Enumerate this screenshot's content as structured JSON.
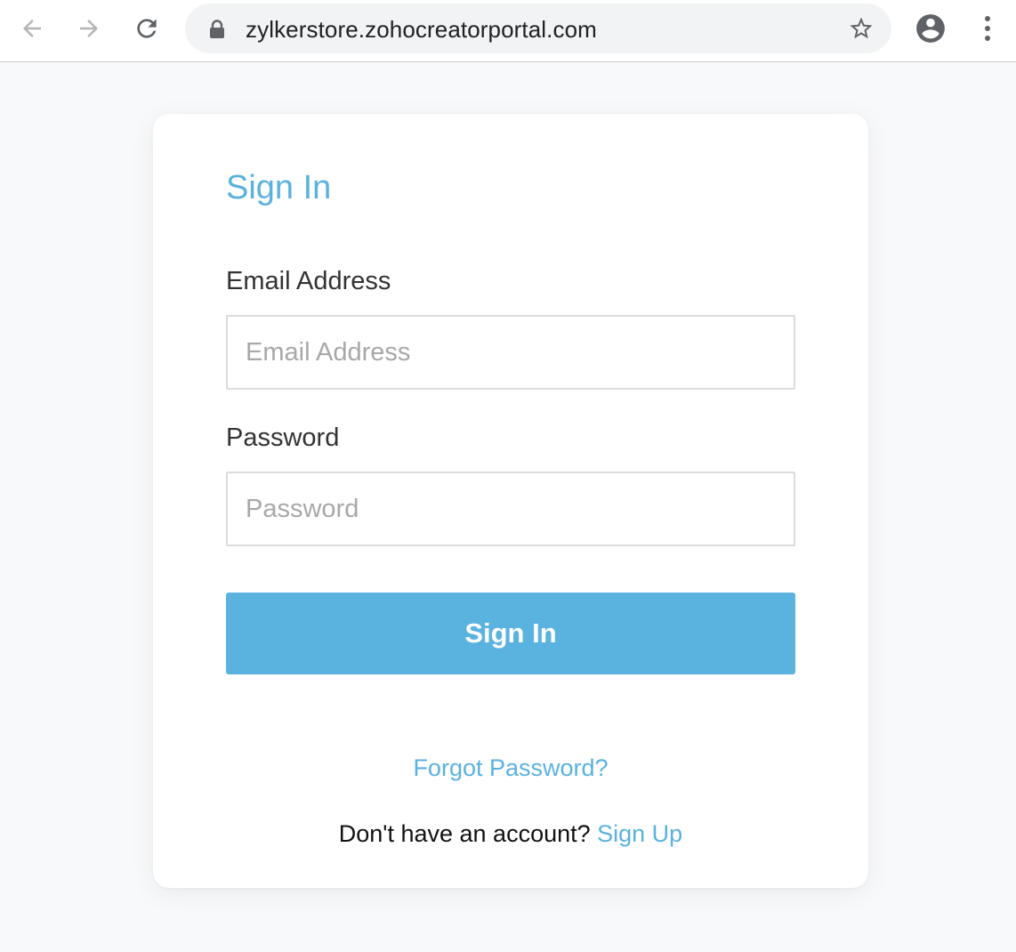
{
  "browser": {
    "url": "zylkerstore.zohocreatorportal.com",
    "icons": {
      "back": "back-arrow-icon",
      "forward": "forward-arrow-icon",
      "reload": "reload-icon",
      "lock": "lock-icon",
      "bookmark": "star-icon",
      "profile": "account-circle-icon",
      "menu": "more-vert-icon"
    }
  },
  "form": {
    "title": "Sign In",
    "email_label": "Email Address",
    "email_placeholder": "Email Address",
    "email_value": "",
    "password_label": "Password",
    "password_placeholder": "Password",
    "password_value": "",
    "submit_label": "Sign In",
    "forgot_label": "Forgot Password?",
    "no_account_text": "Don't have an account?",
    "signup_label": "Sign Up"
  },
  "colors": {
    "accent": "#5ab2de",
    "page_background": "#f8f9fb",
    "card_background": "#ffffff"
  }
}
